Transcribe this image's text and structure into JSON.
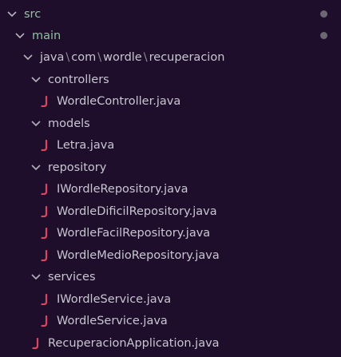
{
  "tree": {
    "src": {
      "label": "src"
    },
    "main": {
      "label": "main"
    },
    "package": {
      "segments": [
        "java",
        "com",
        "wordle",
        "recuperacion"
      ],
      "separator": "\\"
    },
    "controllers": {
      "label": "controllers",
      "files": [
        "WordleController.java"
      ]
    },
    "models": {
      "label": "models",
      "files": [
        "Letra.java"
      ]
    },
    "repository": {
      "label": "repository",
      "files": [
        "IWordleRepository.java",
        "WordleDificilRepository.java",
        "WordleFacilRepository.java",
        "WordleMedioRepository.java"
      ]
    },
    "services": {
      "label": "services",
      "files": [
        "IWordleService.java",
        "WordleService.java"
      ]
    },
    "root_file": "RecuperacionApplication.java",
    "file_icon_glyph": "J"
  },
  "colors": {
    "background": "#1e0e2b",
    "text": "#c8c6d1",
    "folder_modified": "#8fc29f",
    "java_icon": "#d9465f",
    "chevron": "#b4b1bd",
    "badge_dot": "#6b6873"
  },
  "icons": {
    "chevron": "chevron-down-icon",
    "java_file": "java-file-icon",
    "badge": "modified-dot-icon"
  }
}
